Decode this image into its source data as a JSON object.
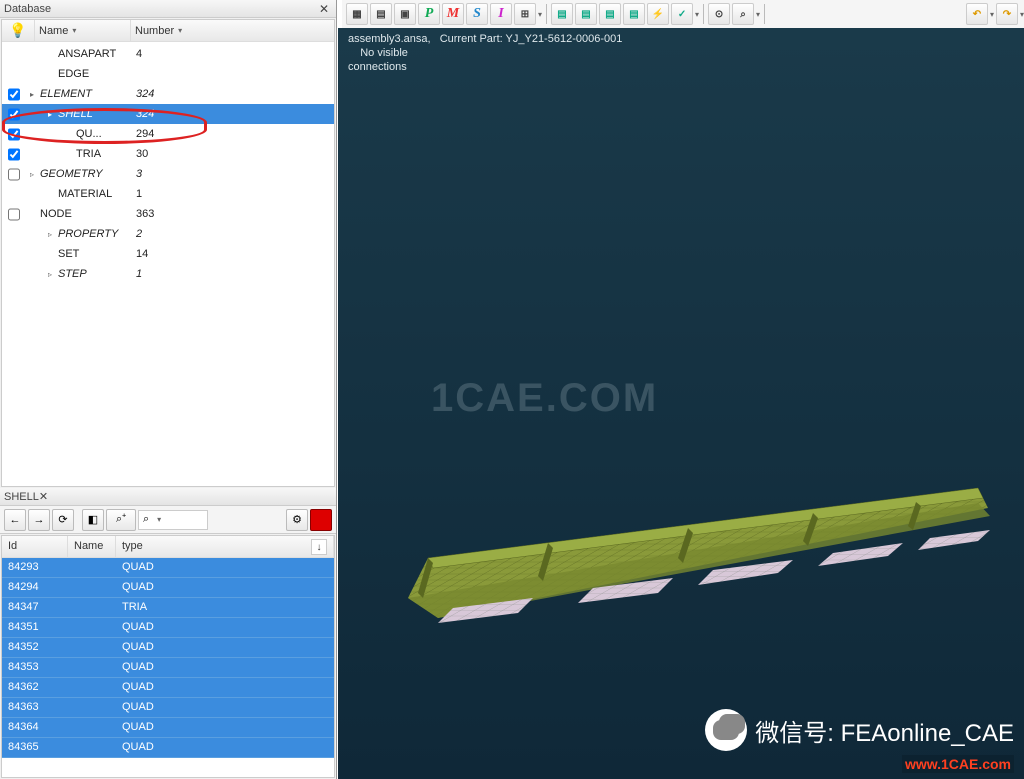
{
  "panels": {
    "database_title": "Database",
    "shell_title": "SHELL"
  },
  "tree": {
    "col_name": "Name",
    "col_number": "Number",
    "rows": [
      {
        "cb": false,
        "indent": 1,
        "exp": "",
        "label": "ANSAPART",
        "num": "4",
        "plain": true
      },
      {
        "cb": false,
        "indent": 1,
        "exp": "",
        "label": "EDGE",
        "num": "",
        "plain": true
      },
      {
        "cb": true,
        "indent": 0,
        "exp": "▸",
        "label": "ELEMENT",
        "num": "324",
        "plain": false
      },
      {
        "cb": true,
        "indent": 1,
        "exp": "▸",
        "label": "SHELL",
        "num": "324",
        "plain": false,
        "sel": true
      },
      {
        "cb": true,
        "indent": 2,
        "exp": "",
        "label": "QU...",
        "num": "294",
        "plain": true
      },
      {
        "cb": true,
        "indent": 2,
        "exp": "",
        "label": "TRIA",
        "num": "30",
        "plain": true
      },
      {
        "cb": false,
        "indent": 0,
        "exp": "▹",
        "label": "GEOMETRY",
        "num": "3",
        "plain": false
      },
      {
        "cb": false,
        "indent": 1,
        "exp": "",
        "label": "MATERIAL",
        "num": "1",
        "plain": true
      },
      {
        "cb": false,
        "indent": 0,
        "exp": "",
        "label": "NODE",
        "num": "363",
        "plain": true
      },
      {
        "cb": false,
        "indent": 1,
        "exp": "▹",
        "label": "PROPERTY",
        "num": "2",
        "plain": false
      },
      {
        "cb": false,
        "indent": 1,
        "exp": "",
        "label": "SET",
        "num": "14",
        "plain": true
      },
      {
        "cb": false,
        "indent": 1,
        "exp": "▹",
        "label": "STEP",
        "num": "1",
        "plain": false
      }
    ]
  },
  "list": {
    "col_id": "Id",
    "col_name": "Name",
    "col_type": "type",
    "rows": [
      {
        "id": "84293",
        "name": "",
        "type": "QUAD"
      },
      {
        "id": "84294",
        "name": "",
        "type": "QUAD"
      },
      {
        "id": "84347",
        "name": "",
        "type": "TRIA"
      },
      {
        "id": "84351",
        "name": "",
        "type": "QUAD"
      },
      {
        "id": "84352",
        "name": "",
        "type": "QUAD"
      },
      {
        "id": "84353",
        "name": "",
        "type": "QUAD"
      },
      {
        "id": "84362",
        "name": "",
        "type": "QUAD"
      },
      {
        "id": "84363",
        "name": "",
        "type": "QUAD"
      },
      {
        "id": "84364",
        "name": "",
        "type": "QUAD"
      },
      {
        "id": "84365",
        "name": "",
        "type": "QUAD"
      }
    ]
  },
  "toolbar": {
    "p": "P",
    "m": "M",
    "s": "S",
    "i": "I"
  },
  "search_placeholder": "⌕",
  "viewport": {
    "line1": "assembly3.ansa,   Current Part: YJ_Y21-5612-0006-001",
    "line2": "    No visible",
    "line3": "connections"
  },
  "watermark": "1CAE.COM",
  "wechat_label": "微信号: FEAonline_CAE",
  "url": "www.1CAE.com"
}
